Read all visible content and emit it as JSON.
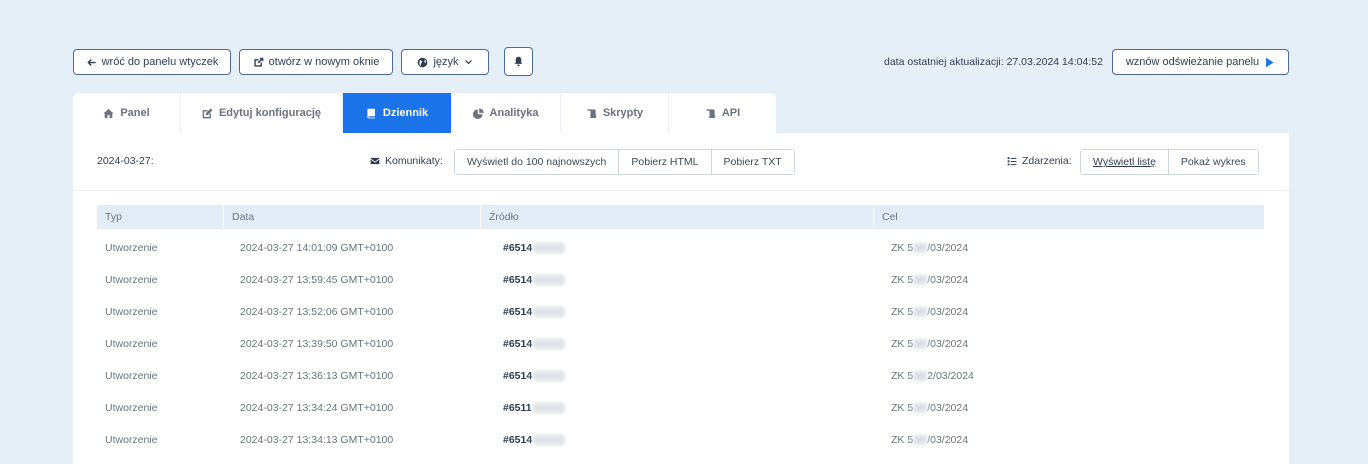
{
  "topbar": {
    "back_label": "wróć do panelu wtyczek",
    "open_new_label": "otwórz w nowym oknie",
    "language_label": "język",
    "update_label": "data ostatniej aktualizacji: 27.03.2024 14:04:52",
    "resume_label": "wznów odświeżanie panelu"
  },
  "tabs": [
    {
      "label": "Panel",
      "icon": "home-icon"
    },
    {
      "label": "Edytuj konfigurację",
      "icon": "edit-icon"
    },
    {
      "label": "Dziennik",
      "icon": "book-icon",
      "active": true
    },
    {
      "label": "Analityka",
      "icon": "pie-chart-icon"
    },
    {
      "label": "Skrypty",
      "icon": "scroll-icon"
    },
    {
      "label": "API",
      "icon": "scroll-icon"
    }
  ],
  "toolbar": {
    "date": "2024-03-27:",
    "messages_label": "Komunikaty:",
    "show_100_label": "Wyświetl do 100 najnowszych",
    "download_html_label": "Pobierz HTML",
    "download_txt_label": "Pobierz TXT",
    "events_label": "Zdarzenia:",
    "show_list_label": "Wyświetl listę",
    "show_chart_label": "Pokaż wykres"
  },
  "table": {
    "headers": [
      "Typ",
      "Data",
      "Źródło",
      "Cel"
    ],
    "rows": [
      {
        "type": "Utworzenie",
        "date": "2024-03-27 14:01:09 GMT+0100",
        "source": "#6514",
        "target_prefix": "ZK 5",
        "target_suffix": "/03/2024"
      },
      {
        "type": "Utworzenie",
        "date": "2024-03-27 13:59:45 GMT+0100",
        "source": "#6514",
        "target_prefix": "ZK 5",
        "target_suffix": "/03/2024"
      },
      {
        "type": "Utworzenie",
        "date": "2024-03-27 13:52:06 GMT+0100",
        "source": "#6514",
        "target_prefix": "ZK 5",
        "target_suffix": "/03/2024"
      },
      {
        "type": "Utworzenie",
        "date": "2024-03-27 13:39:50 GMT+0100",
        "source": "#6514",
        "target_prefix": "ZK 5",
        "target_suffix": "/03/2024"
      },
      {
        "type": "Utworzenie",
        "date": "2024-03-27 13:36:13 GMT+0100",
        "source": "#6514",
        "target_prefix": "ZK 5",
        "target_suffix": "2/03/2024"
      },
      {
        "type": "Utworzenie",
        "date": "2024-03-27 13:34:24 GMT+0100",
        "source": "#6511",
        "target_prefix": "ZK 5",
        "target_suffix": "/03/2024"
      },
      {
        "type": "Utworzenie",
        "date": "2024-03-27 13:34:13 GMT+0100",
        "source": "#6514",
        "target_prefix": "ZK 5",
        "target_suffix": "/03/2024"
      }
    ]
  },
  "colors": {
    "accent": "#1a73e8",
    "background": "#e6eff8",
    "header_row": "#e3edf8"
  }
}
